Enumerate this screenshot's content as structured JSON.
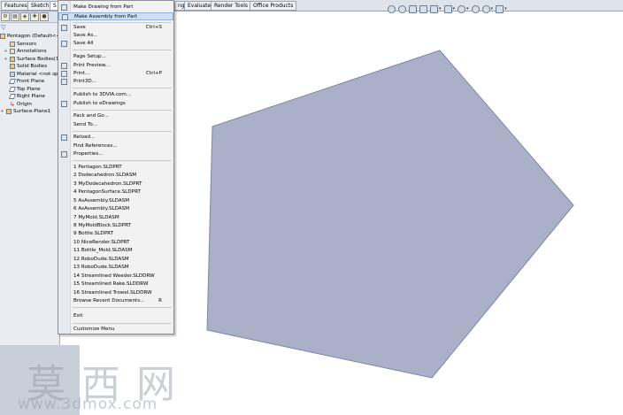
{
  "tabs": [
    "Features",
    "Sketch",
    "S",
    "ng",
    "Evaluate",
    "Render Tools",
    "Office Products"
  ],
  "viewport_toolbar": {
    "icons": [
      "zoom-to-fit-icon",
      "zoom-area-icon",
      "previous-view-icon",
      "section-view-icon",
      "view-orientation-icon",
      "display-style-icon",
      "hide-show-icon",
      "edit-appearance-icon",
      "apply-scene-icon",
      "view-settings-icon"
    ]
  },
  "feature_tree": {
    "filter_icon": "filter-icon",
    "items": [
      {
        "label": "Pentagon  (Default<<",
        "icon": "part-icon"
      },
      {
        "label": "Sensors",
        "icon": "sensor-icon"
      },
      {
        "label": "Annotations",
        "icon": "annotation-icon"
      },
      {
        "label": "Surface Bodies(1)",
        "icon": "surface-body-icon"
      },
      {
        "label": "Solid Bodies",
        "icon": "solid-body-icon"
      },
      {
        "label": "Material <not spe",
        "icon": "material-icon"
      },
      {
        "label": "Front Plane",
        "icon": "plane-icon"
      },
      {
        "label": "Top Plane",
        "icon": "plane-icon"
      },
      {
        "label": "Right Plane",
        "icon": "plane-icon"
      },
      {
        "label": "Origin",
        "icon": "origin-icon"
      },
      {
        "label": "Surface-Plane1",
        "icon": "surface-plane-icon"
      }
    ]
  },
  "menu": {
    "items": [
      {
        "label": "Make Drawing from Part",
        "shortcut": "",
        "icon": "drawing-icon"
      },
      {
        "label": "Make Assembly from Part",
        "shortcut": "",
        "icon": "assembly-icon",
        "highlighted": true
      },
      {
        "sep": true
      },
      {
        "label": "Save",
        "shortcut": "Ctrl+S",
        "icon": "save-icon"
      },
      {
        "label": "Save As...",
        "shortcut": "",
        "icon": ""
      },
      {
        "label": "Save All",
        "shortcut": "",
        "icon": "save-all-icon"
      },
      {
        "sep": true
      },
      {
        "label": "Page Setup...",
        "shortcut": "",
        "icon": ""
      },
      {
        "label": "Print Preview...",
        "shortcut": "",
        "icon": "print-preview-icon"
      },
      {
        "label": "Print...",
        "shortcut": "Ctrl+P",
        "icon": "print-icon"
      },
      {
        "label": "Print3D...",
        "shortcut": "",
        "icon": "print3d-icon"
      },
      {
        "sep": true
      },
      {
        "label": "Publish to 3DVIA.com...",
        "shortcut": "",
        "icon": ""
      },
      {
        "label": "Publish to eDrawings",
        "shortcut": "",
        "icon": "edrawings-icon"
      },
      {
        "sep": true
      },
      {
        "label": "Pack and Go...",
        "shortcut": "",
        "icon": ""
      },
      {
        "label": "Send To...",
        "shortcut": "",
        "icon": ""
      },
      {
        "sep": true
      },
      {
        "label": "Reload...",
        "shortcut": "",
        "icon": "reload-icon"
      },
      {
        "label": "Find References...",
        "shortcut": "",
        "icon": ""
      },
      {
        "label": "Properties...",
        "shortcut": "",
        "icon": "properties-icon"
      },
      {
        "sep": true
      },
      {
        "label": "1 Pentagon.SLDPRT",
        "shortcut": "",
        "icon": ""
      },
      {
        "label": "2 Dodecahedron.SLDASM",
        "shortcut": "",
        "icon": ""
      },
      {
        "label": "3 MyDodecahedron.SLDPRT",
        "shortcut": "",
        "icon": ""
      },
      {
        "label": "4 PentagonSurface.SLDPRT",
        "shortcut": "",
        "icon": ""
      },
      {
        "label": "5 AsAssembly.SLDASM",
        "shortcut": "",
        "icon": ""
      },
      {
        "label": "6 AsAssembly.SLDASM",
        "shortcut": "",
        "icon": ""
      },
      {
        "label": "7 MyMold.SLDASM",
        "shortcut": "",
        "icon": ""
      },
      {
        "label": "8 MyMoldBlock.SLDPRT",
        "shortcut": "",
        "icon": ""
      },
      {
        "label": "9 Bottle.SLDPRT",
        "shortcut": "",
        "icon": ""
      },
      {
        "label": "10 NiceRender.SLDPRT",
        "shortcut": "",
        "icon": ""
      },
      {
        "label": "11 Bottle_Mold.SLDASM",
        "shortcut": "",
        "icon": ""
      },
      {
        "label": "12 RoboDude.SLDASM",
        "shortcut": "",
        "icon": ""
      },
      {
        "label": "13 RoboDude.SLDASM",
        "shortcut": "",
        "icon": ""
      },
      {
        "label": "14 Streamlined Weeder.SLDDRW",
        "shortcut": "",
        "icon": ""
      },
      {
        "label": "15 Streamlined Rake.SLDDRW",
        "shortcut": "",
        "icon": ""
      },
      {
        "label": "16 Streamlined Trowel.SLDDRW",
        "shortcut": "",
        "icon": ""
      },
      {
        "label": "Browse Recent Documents...",
        "shortcut": "R",
        "icon": ""
      },
      {
        "sep": true
      },
      {
        "label": "Exit",
        "shortcut": "",
        "icon": ""
      },
      {
        "sep": true
      },
      {
        "label": "Customize Menu",
        "shortcut": "",
        "icon": ""
      }
    ]
  },
  "model": {
    "shape": "pentagon",
    "fill": "#a9b0c8",
    "stroke": "#7e86a2"
  },
  "watermark": {
    "text": "莫西网",
    "url": "www.3dmox.com"
  }
}
